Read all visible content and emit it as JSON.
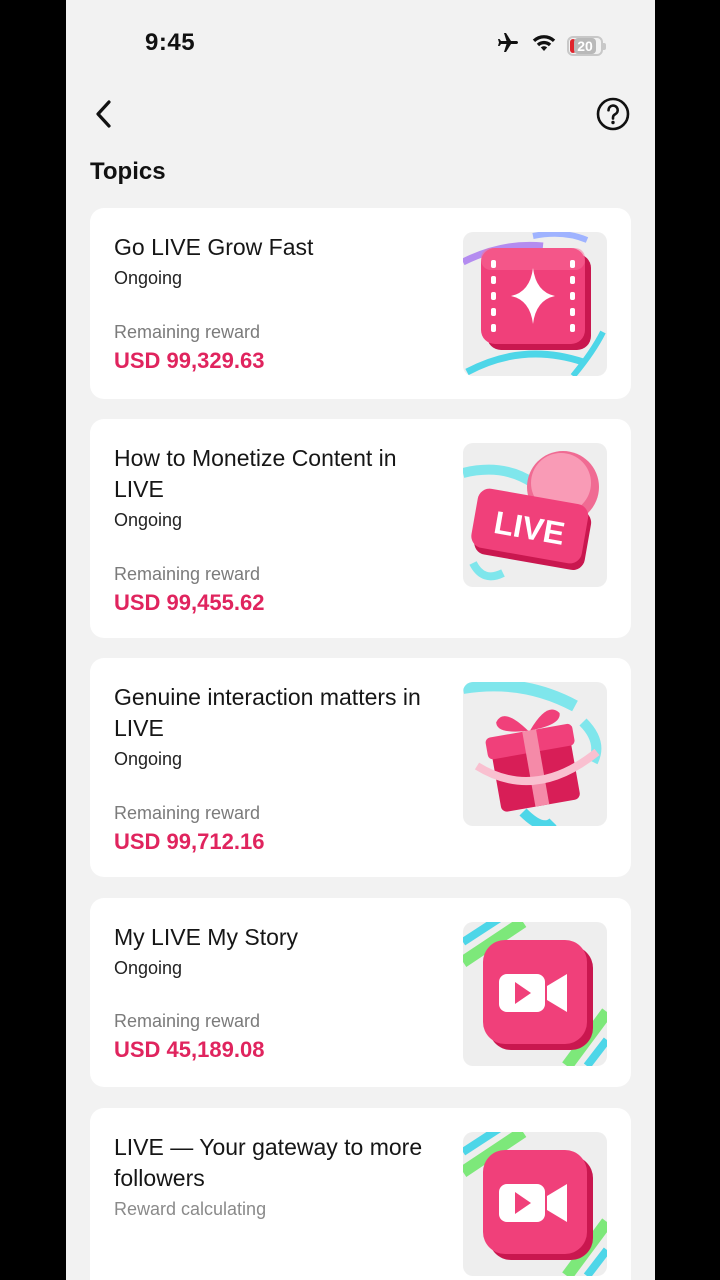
{
  "status_bar": {
    "time": "9:45",
    "battery": "20"
  },
  "header": {
    "back_icon": "chevron-left-icon",
    "help_icon": "question-circle-icon"
  },
  "section": {
    "title": "Topics"
  },
  "colors": {
    "accent": "#e0245e",
    "background": "#f2f2f2",
    "card": "#ffffff"
  },
  "topics": [
    {
      "title": "Go LIVE Grow Fast",
      "status": "Ongoing",
      "reward_label": "Remaining reward",
      "reward_value": "USD 99,329.63",
      "icon": "sparkle-clapper-icon"
    },
    {
      "title": "How to Monetize Content in LIVE",
      "status": "Ongoing",
      "reward_label": "Remaining reward",
      "reward_value": "USD 99,455.62",
      "icon": "live-badge-icon",
      "icon_text": "LIVE"
    },
    {
      "title": "Genuine interaction matters in LIVE",
      "status": "Ongoing",
      "reward_label": "Remaining reward",
      "reward_value": "USD 99,712.16",
      "icon": "gift-box-icon"
    },
    {
      "title": "My LIVE My Story",
      "status": "Ongoing",
      "reward_label": "Remaining reward",
      "reward_value": "USD 45,189.08",
      "icon": "video-camera-icon"
    },
    {
      "title": "LIVE — Your gateway to more followers",
      "status": "Reward calculating",
      "icon": "video-camera-icon"
    }
  ]
}
